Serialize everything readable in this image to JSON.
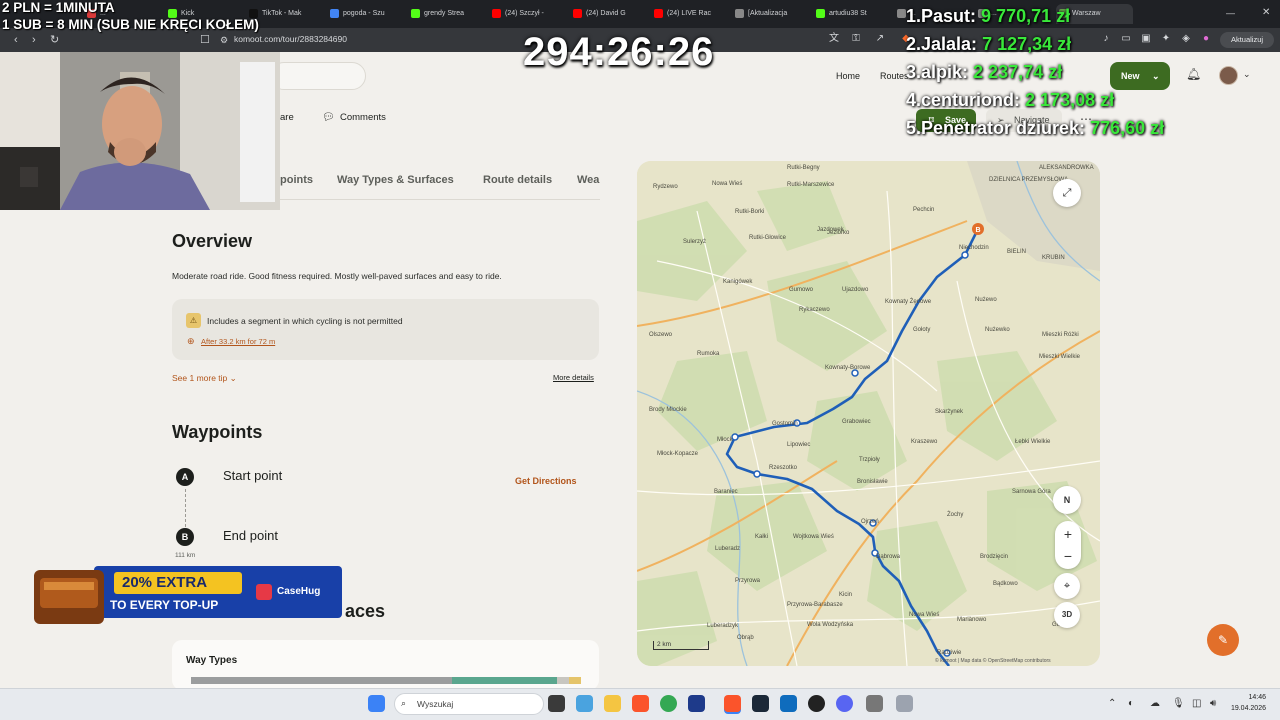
{
  "overlay": {
    "line1": "2 PLN = 1MINUTA",
    "line2": "1 SUB = 8 MIN (SUB NIE KRĘCI KOŁEM)",
    "timer": "294:26:26",
    "leaderboard": [
      {
        "name": "1.Pasut:",
        "amount": "9 770,71 zł"
      },
      {
        "name": "2.Jalala:",
        "amount": "7 127,34 zł"
      },
      {
        "name": "3.alpik:",
        "amount": "2 237,74 zł"
      },
      {
        "name": "4.centuriond:",
        "amount": "2 173,08 zł"
      },
      {
        "name": "5.Penetrator dziurek:",
        "amount": "776,60 zł"
      }
    ]
  },
  "browser": {
    "tabs": [
      {
        "label": "...",
        "color": "#d93a3a"
      },
      {
        "label": "Kick",
        "color": "#53fc18"
      },
      {
        "label": "TikTok - Mak",
        "color": "#111111"
      },
      {
        "label": "pogoda - Szu",
        "color": "#4285f4"
      },
      {
        "label": "grendy Strea",
        "color": "#53fc18"
      },
      {
        "label": "(24) Szczył -",
        "color": "#ff0000"
      },
      {
        "label": "(24) David G",
        "color": "#ff0000"
      },
      {
        "label": "(24) LIVE Rac",
        "color": "#ff0000"
      },
      {
        "label": "[Aktualizacja",
        "color": "#888888"
      },
      {
        "label": "artudiu38 St",
        "color": "#53fc18"
      },
      {
        "label": "...",
        "color": "#888888"
      },
      {
        "label": "...",
        "color": "#888888"
      },
      {
        "label": "Warszaw",
        "color": "#6aa84f"
      }
    ],
    "url": "komoot.com/tour/2883284690",
    "update_label": "Aktualizuj"
  },
  "komoot": {
    "nav": {
      "home": "Home",
      "routes": "Routes",
      "new": "New"
    },
    "actions": {
      "share": "are",
      "comments": "Comments",
      "save": "Save",
      "navigate": "Navigate"
    },
    "tabs": [
      "points",
      "Way Types & Surfaces",
      "Route details",
      "Wea"
    ],
    "overview": {
      "title": "Overview",
      "description": "Moderate road ride. Good fitness required. Mostly well-paved surfaces and easy to ride.",
      "tip": "Includes a segment in which cycling is not permitted",
      "tip_link": "After 33.2 km for 72 m",
      "more_tip": "See 1 more tip",
      "more_details": "More details"
    },
    "waypoints": {
      "title": "Waypoints",
      "start_letter": "A",
      "start": "Start point",
      "get_directions": "Get Directions",
      "end_letter": "B",
      "end": "End point",
      "distance": "111 km"
    },
    "surfaces_title": "aces",
    "way_types": {
      "title": "Way Types",
      "segments": [
        {
          "fraction": 0.67,
          "color": "#9b9d9e"
        },
        {
          "fraction": 0.27,
          "color": "#5aa68e"
        },
        {
          "fraction": 0.03,
          "color": "#c8c6c0"
        },
        {
          "fraction": 0.03,
          "color": "#e5c46a"
        }
      ]
    },
    "map": {
      "places": [
        "Rutki-Begny",
        "Rydzewo",
        "Nowa Wieś",
        "Rutki-Marszewice",
        "Rutki-Borki",
        "ALEKSANDROWKA",
        "DZIELNICA PRZEMYSŁOWA",
        "Pechcin",
        "Sulerzyż",
        "Rutki-Głowice",
        "Jeziorko",
        "Niechodzin",
        "Jazdowek",
        "BIELIN",
        "KRUBIN",
        "Kanigówek",
        "Gumowo",
        "Ujazdowo",
        "Nużewo",
        "Kownaty Żędowe",
        "Rykaczewo",
        "Gołoty",
        "Nużewko",
        "Olszewo",
        "Rumoka",
        "Mieszki Różki",
        "Mieszki Wielkie",
        "Kownaty-Borowe",
        "Brody Młockie",
        "Skarżynek",
        "Gostomin",
        "Grabowiec",
        "Kraszewo",
        "Łebki Wielkie",
        "Młock",
        "Lipowiec",
        "Młock-Kopacze",
        "Rzeszotko",
        "Trzpioły",
        "Baraniec",
        "Bronisławie",
        "Sarnowa Góra",
        "Ojrzeń",
        "Żochy",
        "Kałki",
        "Wojtkowa Wieś",
        "Dąbrowa",
        "Luberadz",
        "Brodzięcin",
        "Bądkowo",
        "Przyrowa",
        "Kicin",
        "Przyrowa-Barabasze",
        "Nowa Wieś",
        "Gutków",
        "Luberadzyk",
        "Obrąb",
        "Wola Wodzyńska",
        "Mariànowo",
        "Radziwie"
      ],
      "compass": "N",
      "zoom_in": "+",
      "zoom_out": "−",
      "view_3d": "3D",
      "scale": "2 km",
      "attribution": "© komoot | Map data © OpenStreetMap contributors",
      "marker_end": "B"
    }
  },
  "promo": {
    "line1": "20% EXTRA",
    "line2": "TO EVERY TOP-UP",
    "brand": "CaseHug"
  },
  "taskbar": {
    "search": "Wyszukaj",
    "time": "14:46",
    "date": "19.04.2026"
  }
}
